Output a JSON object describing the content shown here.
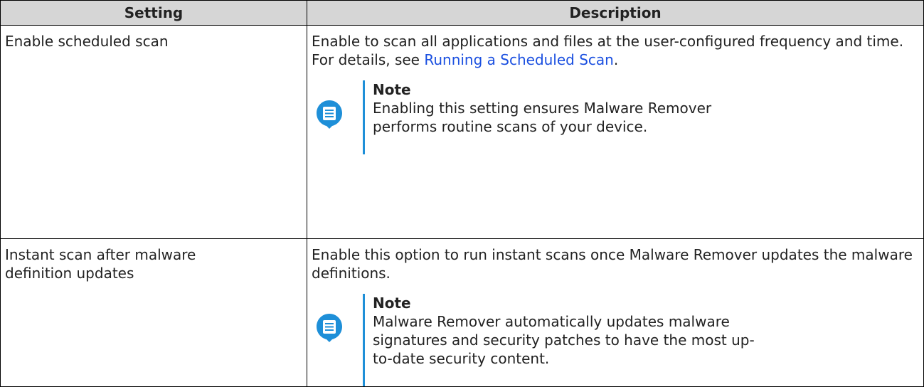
{
  "table": {
    "headers": {
      "setting": "Setting",
      "description": "Description"
    },
    "rows": [
      {
        "setting": "Enable scheduled scan",
        "description_line1": "Enable to scan all applications and files at the user-configured frequency and time.",
        "description_line2_prefix": "For details, see ",
        "description_link": "Running a Scheduled Scan",
        "description_line2_suffix": ".",
        "note_title": "Note",
        "note_text": "Enabling this setting ensures Malware Remover performs routine scans of your device."
      },
      {
        "setting": "Instant scan after malware definition updates",
        "description_line1": "Enable this option to run instant scans once Malware Remover updates the malware definitions.",
        "note_title": "Note",
        "note_text": "Malware Remover automatically updates malware signatures and security patches to have the most up-to-date security content."
      }
    ]
  },
  "colors": {
    "header_bg": "#d6d6d6",
    "link": "#1a4fe0",
    "note_accent": "#1e8fd8"
  },
  "icons": {
    "note": "note-speech-bubble-icon"
  }
}
